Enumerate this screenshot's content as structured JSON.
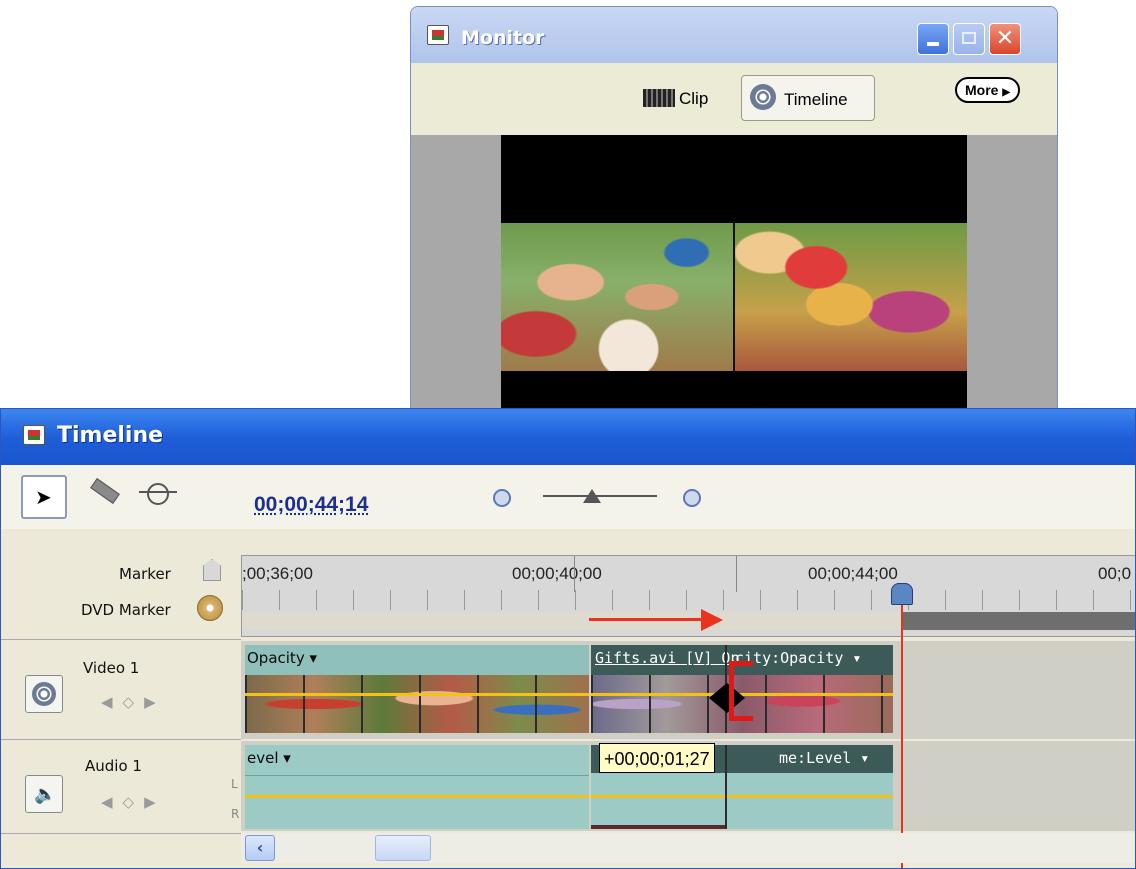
{
  "monitor": {
    "title": "Monitor",
    "tabs": [
      {
        "label": "Clip",
        "icon": "film-strip-icon",
        "selected": false
      },
      {
        "label": "Timeline",
        "icon": "film-reel-icon",
        "selected": true
      }
    ],
    "more_label": "More",
    "preview_description": "split-screen birthday party footage"
  },
  "timeline": {
    "title": "Timeline",
    "timecode": "00;00;44;14",
    "tools": [
      "selection-tool-icon",
      "razor-tool-icon",
      "time-stretch-tool-icon"
    ],
    "ruler": {
      "labels": [
        ";00;36;00",
        "00;00;40;00",
        "00;00;44;00",
        "00;0"
      ]
    },
    "marker_labels": {
      "marker": "Marker",
      "dvd_marker": "DVD Marker"
    },
    "tracks": {
      "video": {
        "name": "Video 1",
        "clips": [
          {
            "label": "Opacity ▾"
          },
          {
            "label": "Gifts.avi [V] Op",
            "label2": "city:Opacity ▾"
          }
        ]
      },
      "audio": {
        "name": "Audio 1",
        "channels": [
          "L",
          "R"
        ],
        "clips": [
          {
            "label": "evel ▾"
          },
          {
            "label": "me:Level ▾"
          }
        ]
      }
    },
    "drag_tooltip": "+00;00;01;27"
  },
  "colors": {
    "titlebar_blue": "#1f5fd9",
    "timecode_text": "#1c2f8c",
    "clip_teal": "#8fc0bb",
    "playhead_red": "#e8331f",
    "rubberband_yellow": "#f3c21a"
  }
}
